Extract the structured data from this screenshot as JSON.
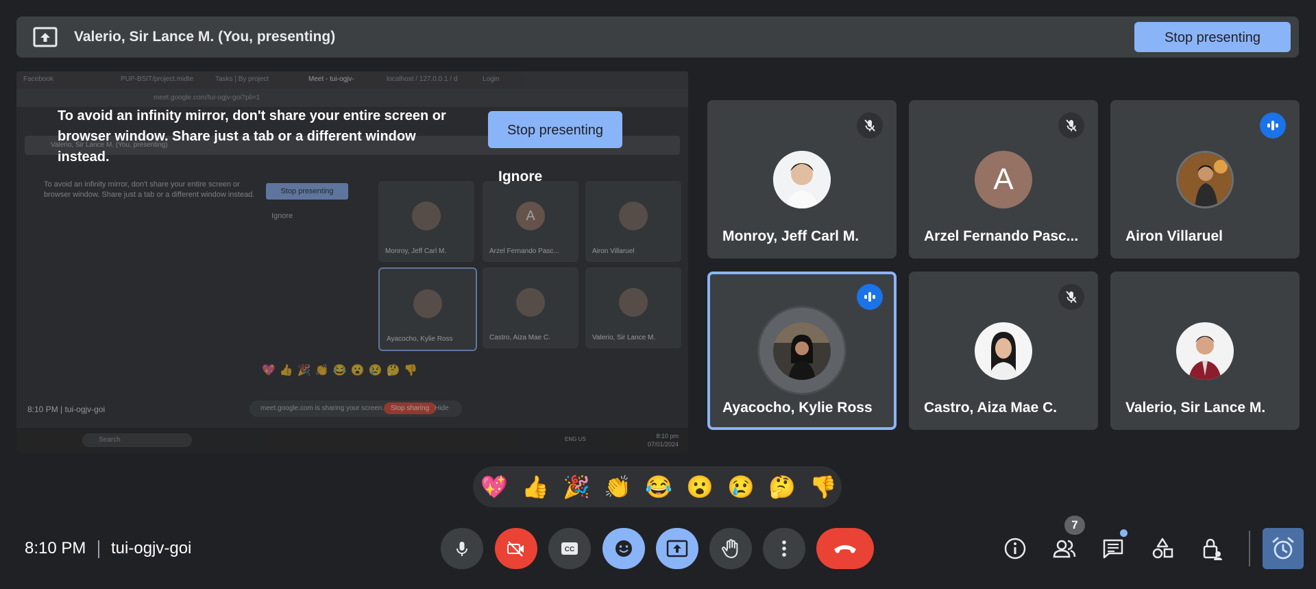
{
  "banner": {
    "title": "Valerio, Sir Lance M. (You, presenting)",
    "stop_label": "Stop presenting"
  },
  "share_preview": {
    "warning": "To avoid an infinity mirror, don't share your entire screen or browser window. Share just a tab or a different window instead.",
    "stop_label": "Stop presenting",
    "ignore_label": "Ignore",
    "mirror": {
      "tabs": [
        "Facebook",
        "PUP-BSIT/project.midte",
        "Tasks | By project",
        "Meet - tui-ogjv-",
        "localhost / 127.0.0.1 / d",
        "Login"
      ],
      "url": "meet.google.com/tui-ogjv-goi?pli=1",
      "banner_title": "Valerio, Sir Lance M. (You, presenting)",
      "warning": "To avoid an infinity mirror, don't share your entire screen or browser window. Share just a tab or a different window instead.",
      "stop_label": "Stop presenting",
      "ignore_label": "Ignore",
      "participants": [
        "Monroy, Jeff Carl M.",
        "Arzel Fernando Pasc...",
        "Airon Villaruel",
        "Ayacocho, Kylie Ross",
        "Castro, Aiza Mae C.",
        "Valerio, Sir Lance M."
      ],
      "letter": "A",
      "emojis": "💖👍🎉👏😂😮😢🤔👎",
      "time": "8:10 PM",
      "meeting_code": "tui-ogjv-goi",
      "sharing_text": "meet.google.com is sharing your screen.",
      "stop_sharing_label": "Stop sharing",
      "hide_label": "Hide",
      "taskbar_search": "Search",
      "taskbar_lang": "ENG US",
      "taskbar_time": "8:10 pm",
      "taskbar_date": "07/01/2024"
    }
  },
  "participants": [
    {
      "name": "Monroy, Jeff Carl M.",
      "status": "muted",
      "avatar": "photo"
    },
    {
      "name": "Arzel Fernando Pasc...",
      "status": "muted",
      "avatar": "letter",
      "letter": "A"
    },
    {
      "name": "Airon Villaruel",
      "status": "speaking",
      "avatar": "photo"
    },
    {
      "name": "Ayacocho, Kylie Ross",
      "status": "speaking",
      "avatar": "photo",
      "active": true
    },
    {
      "name": "Castro, Aiza Mae C.",
      "status": "muted",
      "avatar": "photo"
    },
    {
      "name": "Valerio, Sir Lance M.",
      "status": "none",
      "avatar": "photo"
    }
  ],
  "reactions": [
    "💖",
    "👍",
    "🎉",
    "👏",
    "😂",
    "😮",
    "😢",
    "🤔",
    "👎"
  ],
  "footer": {
    "time": "8:10 PM",
    "meeting_code": "tui-ogjv-goi",
    "people_count": "7"
  },
  "colors": {
    "background": "#202124",
    "tile": "#3c4043",
    "accent": "#8ab4f8",
    "danger": "#ea4335",
    "speaking": "#1a73e8"
  }
}
